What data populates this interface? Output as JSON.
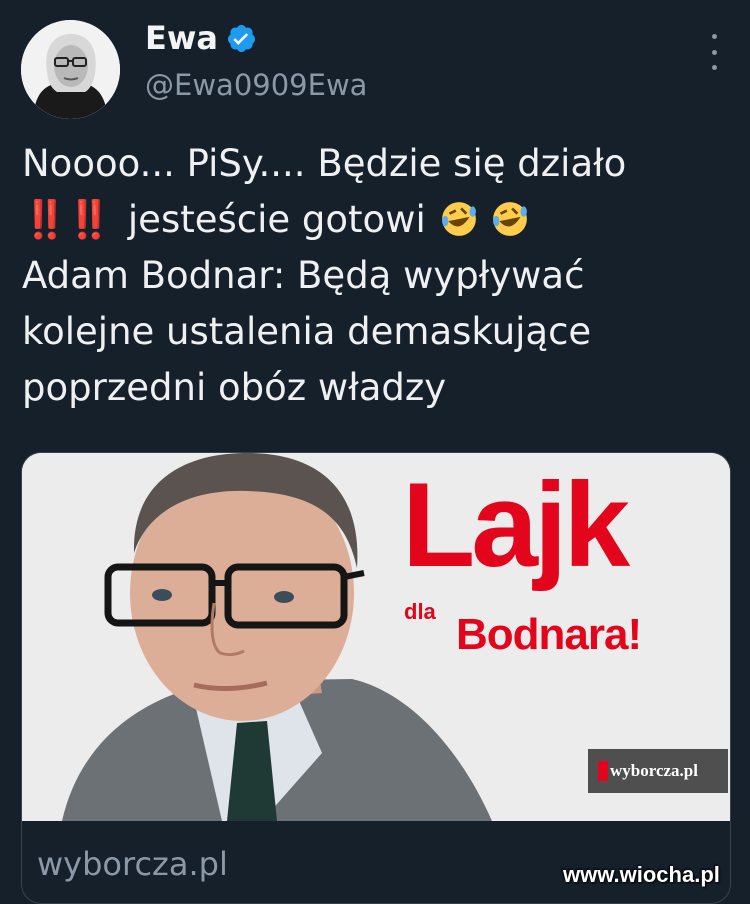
{
  "author": {
    "name": "Ewa",
    "handle": "@Ewa0909Ewa",
    "verified_color": "#1d9bf0"
  },
  "menu": {
    "icon": "more-vertical-icon"
  },
  "tweet": {
    "line1": "Noooo... PiSy.... Będzie się działo",
    "line2_marks": "‼️‼️",
    "line2_text": "jesteście gotowi",
    "line2_emoji": "rolling-on-floor-laughing-icon",
    "line3": "Adam Bodnar: Będą wypływać",
    "line4": "kolejne ustalenia demaskujące",
    "line5": "poprzedni obóz władzy"
  },
  "card": {
    "image_text_1": "Lajk",
    "image_text_2": "dla",
    "image_text_3": "Bodnara!",
    "image_logo": "wyborcza.pl",
    "domain": "wyborcza.pl",
    "accent_color": "#e3051b"
  },
  "watermark": "www.wiocha.pl"
}
